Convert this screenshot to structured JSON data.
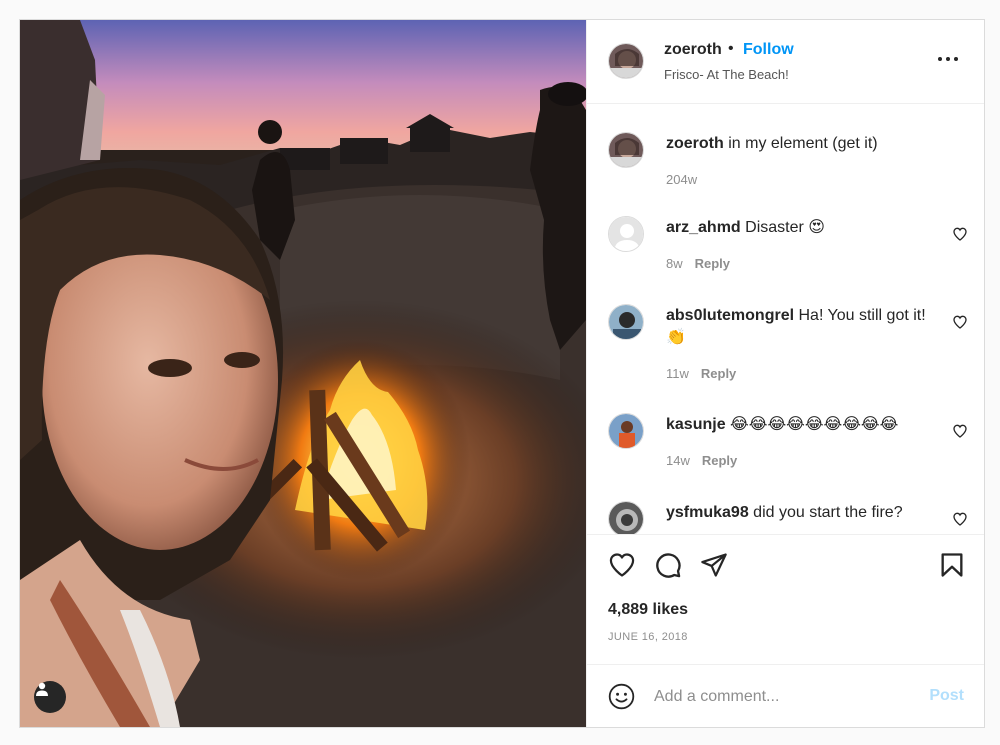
{
  "post": {
    "author": "zoeroth",
    "follow_label": "Follow",
    "dot": "•",
    "location": "Frisco- At The Beach!",
    "caption": {
      "user": "zoeroth",
      "text": "in my element (get it)",
      "age": "204w"
    },
    "comments": [
      {
        "user": "arz_ahmd",
        "text": "Disaster 😍",
        "age": "8w",
        "reply_label": "Reply"
      },
      {
        "user": "abs0lutemongrel",
        "text": "Ha! You still got it! 👏",
        "age": "11w",
        "reply_label": "Reply"
      },
      {
        "user": "kasunje",
        "text": "😂😂😂😂😂😂😂😂😂",
        "age": "14w",
        "reply_label": "Reply"
      },
      {
        "user": "ysfmuka98",
        "text": "did you start the fire?"
      }
    ],
    "likes": "4,889 likes",
    "date": "JUNE 16, 2018",
    "add_comment_placeholder": "Add a comment...",
    "post_label": "Post"
  },
  "icons": {
    "more": "more-options-icon",
    "like": "heart-icon",
    "comment": "comment-icon",
    "share": "share-icon",
    "save": "bookmark-icon",
    "emoji": "emoji-icon",
    "user_tag": "user-tag-icon"
  },
  "colors": {
    "accent": "#0095f6",
    "post_disabled": "#b2dffc",
    "muted": "#8e8e8e"
  }
}
